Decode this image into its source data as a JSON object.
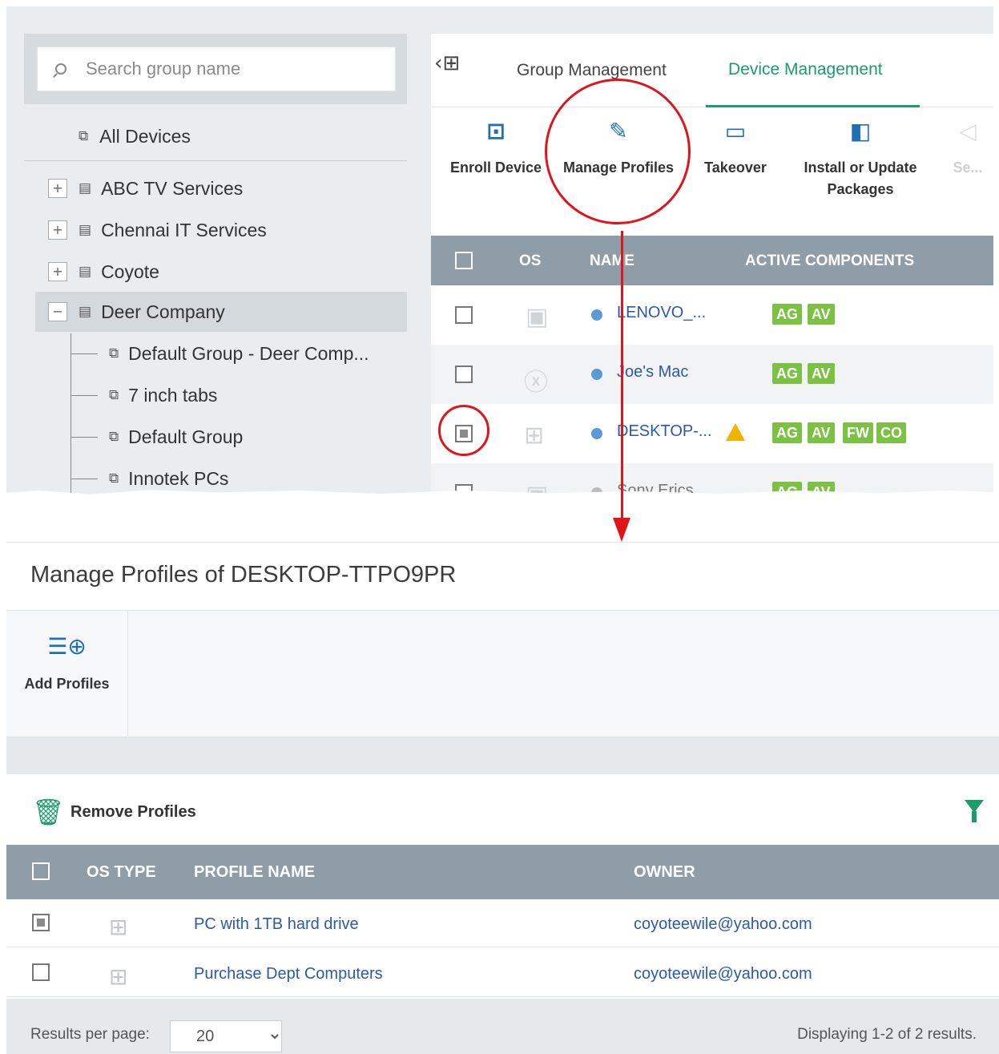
{
  "search": {
    "placeholder": "Search group name"
  },
  "tree": {
    "all_devices": "All Devices",
    "groups": [
      {
        "label": "ABC TV Services",
        "toggle": "+"
      },
      {
        "label": "Chennai IT Services",
        "toggle": "+"
      },
      {
        "label": "Coyote",
        "toggle": "+"
      },
      {
        "label": "Deer Company",
        "toggle": "−"
      }
    ],
    "subgroups": [
      "Default Group - Deer Comp...",
      "7 inch tabs",
      "Default Group",
      "Innotek PCs"
    ]
  },
  "tabs": [
    {
      "label": "Group Management"
    },
    {
      "label": "Device Management"
    }
  ],
  "toolbar": {
    "enroll": "Enroll Device",
    "manage": "Manage Profiles",
    "takeover": "Takeover",
    "install_line1": "Install or Update",
    "install_line2": "Packages",
    "faded": "Se..."
  },
  "device_grid": {
    "headers": {
      "os": "OS",
      "name": "NAME",
      "components": "ACTIVE COMPONENTS"
    },
    "rows": [
      {
        "name": "LENOVO_...",
        "os": "android",
        "badges": [
          "AG",
          "AV"
        ],
        "checked": false,
        "warning": false
      },
      {
        "name": "Joe's Mac",
        "os": "mac",
        "badges": [
          "AG",
          "AV"
        ],
        "checked": false,
        "warning": false
      },
      {
        "name": "DESKTOP-...",
        "os": "windows",
        "badges": [
          "AG",
          "AV",
          "FW",
          "CO"
        ],
        "checked": true,
        "warning": true
      },
      {
        "name": "Sony Erics...",
        "os": "android",
        "badges": [
          "AG",
          "AV"
        ],
        "checked": false,
        "warning": false
      }
    ]
  },
  "dialog": {
    "title": "Manage Profiles of DESKTOP-TTPO9PR",
    "add_label": "Add Profiles",
    "remove_label": "Remove Profiles",
    "headers": {
      "os_type": "OS TYPE",
      "profile_name": "PROFILE NAME",
      "owner": "OWNER"
    },
    "rows": [
      {
        "profile": "PC with 1TB hard drive",
        "owner": "coyoteewile@yahoo.com",
        "checked": true
      },
      {
        "profile": "Purchase Dept Computers",
        "owner": "coyoteewile@yahoo.com",
        "checked": false
      }
    ],
    "footer": {
      "results_per_page_label": "Results per page:",
      "per_page_value": "20",
      "displaying": "Displaying 1-2 of 2 results."
    }
  },
  "colors": {
    "accent_green": "#1a9c6b",
    "badge_green": "#7cc242",
    "header_grey": "#8e9da8",
    "link_blue": "#2a5aa8",
    "highlight_red": "#e0151b"
  }
}
